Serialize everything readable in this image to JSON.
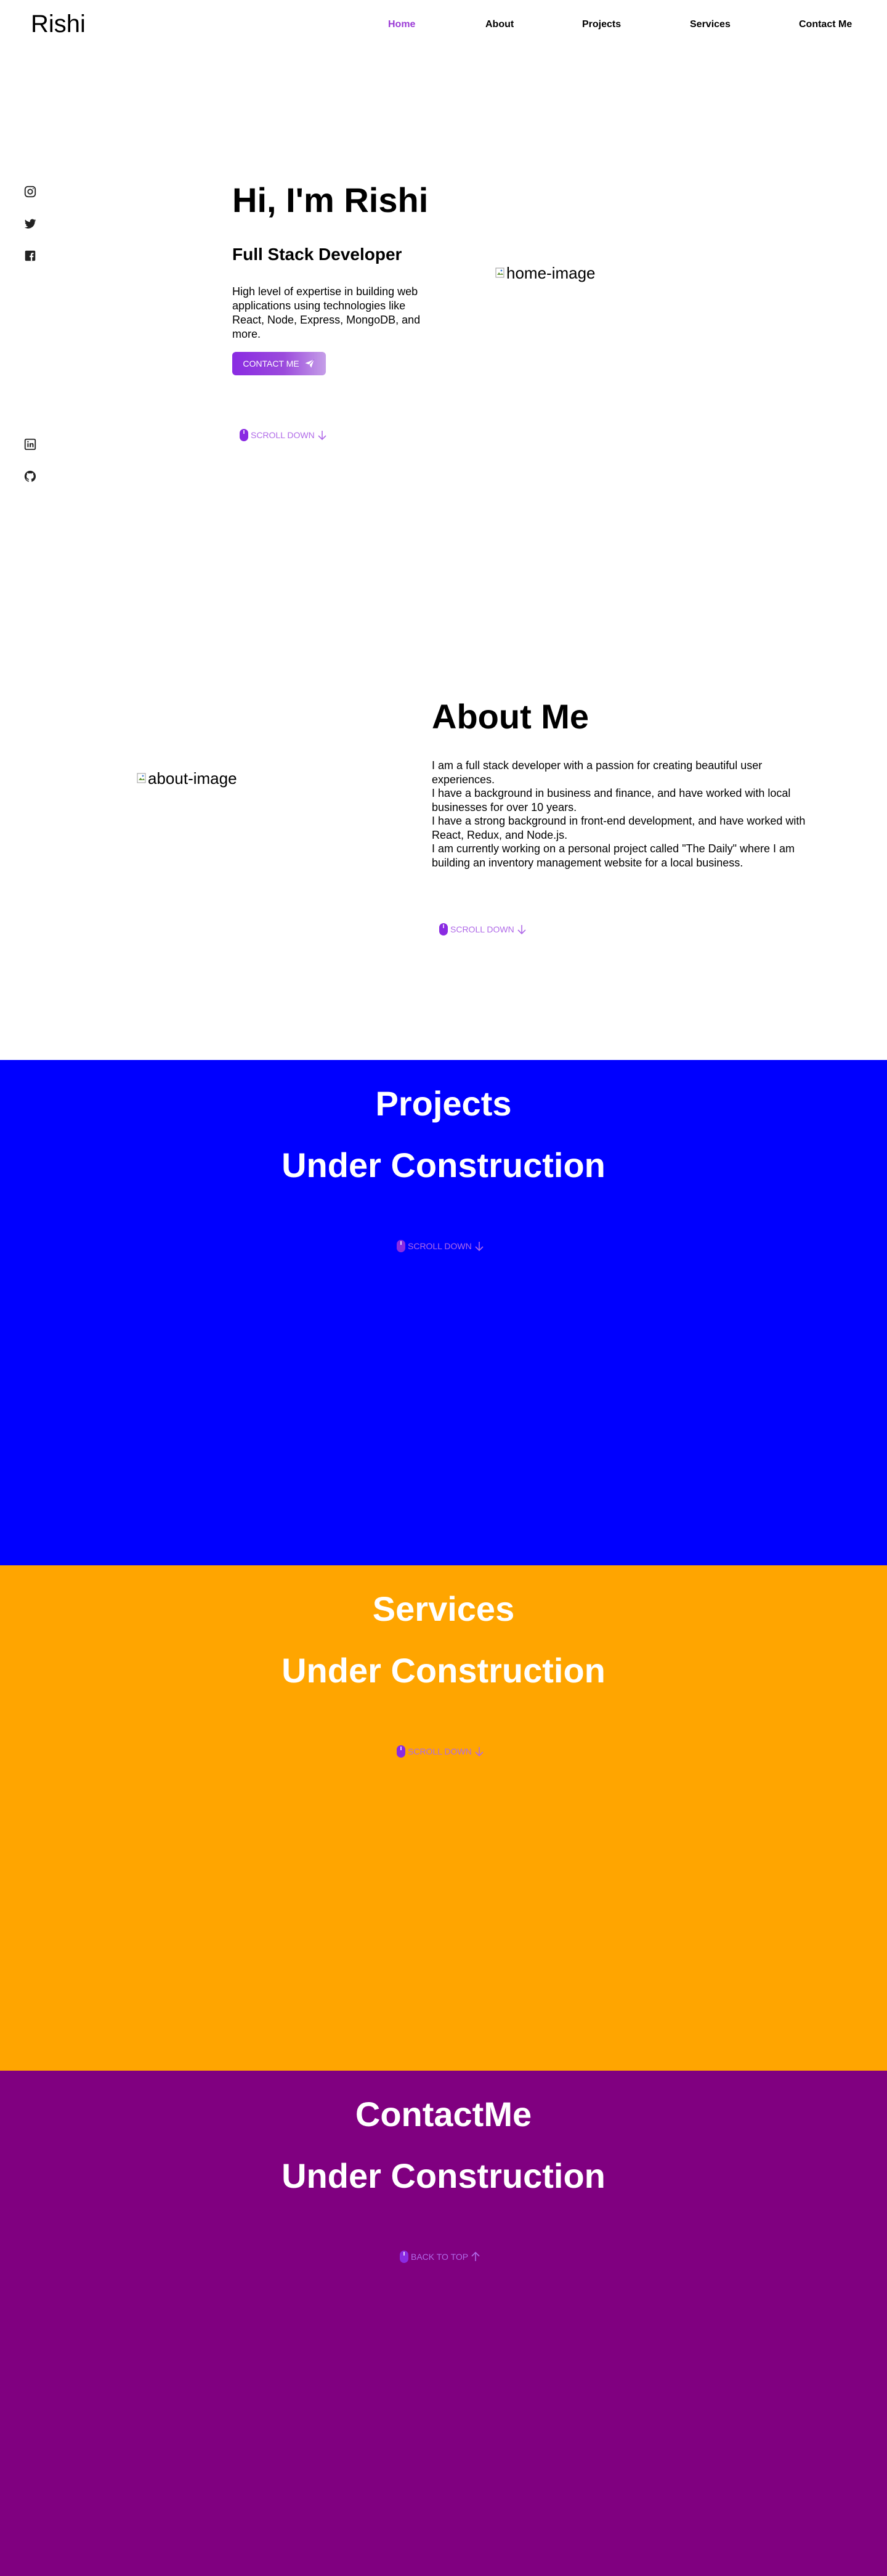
{
  "header": {
    "logo": "Rishi",
    "nav": [
      {
        "label": "Home"
      },
      {
        "label": "About"
      },
      {
        "label": "Projects"
      },
      {
        "label": "Services"
      },
      {
        "label": "Contact Me"
      }
    ]
  },
  "social": {
    "icons": [
      "instagram-icon",
      "twitter-icon",
      "facebook-icon",
      "linkedin-icon",
      "github-icon"
    ]
  },
  "hero": {
    "title": "Hi, I'm Rishi",
    "subtitle": "Full Stack Developer",
    "description": "High level of expertise in building web applications using technologies like React, Node, Express, MongoDB, and more.",
    "button_label": "CONTACT ME",
    "image_alt": "home-image",
    "scroll_label": "SCROLL DOWN"
  },
  "about": {
    "title": "About Me",
    "image_alt": "about-image",
    "paragraphs": [
      "I am a full stack developer with a passion for creating beautiful user experiences.",
      "I have a background in business and finance, and have worked with local businesses for over 10 years.",
      "I have a strong background in front-end development, and have worked with React, Redux, and Node.js.",
      "I am currently working on a personal project called \"The Daily\" where I am building an inventory management website for a local business."
    ],
    "scroll_label": "SCROLL DOWN"
  },
  "projects": {
    "title": "Projects",
    "subtitle": "Under Construction",
    "scroll_label": "SCROLL DOWN",
    "background": "#0000ff"
  },
  "services": {
    "title": "Services",
    "subtitle": "Under Construction",
    "scroll_label": "SCROLL DOWN",
    "background": "#ffa500"
  },
  "contact": {
    "title": "ContactMe",
    "subtitle": "Under Construction",
    "scroll_label": "BACK TO TOP",
    "background": "#800080"
  },
  "colors": {
    "accent": "#9b3bd6",
    "scroll_text": "#b06ae8"
  }
}
